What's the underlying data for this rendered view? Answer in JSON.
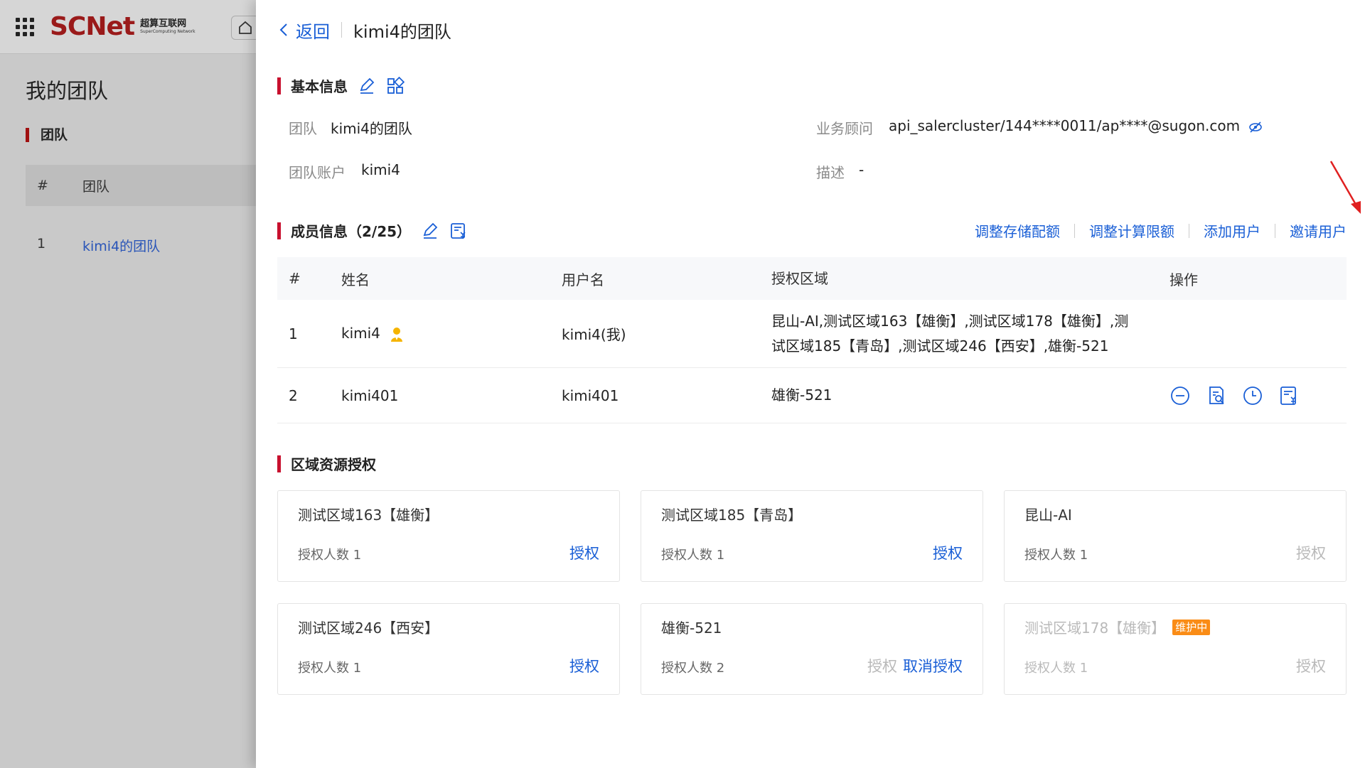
{
  "background_page": {
    "logo_main": "SCNet",
    "logo_cn": "超算互联网",
    "logo_en": "SuperComputing Network",
    "title": "我的团队",
    "section": "团队",
    "table_headers": [
      "#",
      "团队"
    ],
    "rows": [
      {
        "index": "1",
        "name": "kimi4的团队"
      }
    ]
  },
  "header": {
    "back_label": "返回",
    "title": "kimi4的团队"
  },
  "basic_info": {
    "heading": "基本信息",
    "team_label": "团队",
    "team_value": "kimi4的团队",
    "account_label": "团队账户",
    "account_value": "kimi4",
    "advisor_label": "业务顾问",
    "advisor_value": "api_salercluster/144****0011/ap****@sugon.com",
    "desc_label": "描述",
    "desc_value": "-"
  },
  "members": {
    "heading": "成员信息（2/25）",
    "actions": [
      "调整存储配额",
      "调整计算限额",
      "添加用户",
      "邀请用户"
    ],
    "headers": [
      "#",
      "姓名",
      "用户名",
      "授权区域",
      "操作"
    ],
    "rows": [
      {
        "index": "1",
        "name": "kimi4",
        "username": "kimi4(我)",
        "areas_line1": "昆山-AI,测试区域163【雄衡】,测试区域178【雄衡】,测",
        "areas_line2": "试区域185【青岛】,测试区域246【西安】,雄衡-521"
      },
      {
        "index": "2",
        "name": "kimi401",
        "username": "kimi401",
        "areas_line1": "雄衡-521",
        "areas_line2": ""
      }
    ]
  },
  "regions": {
    "heading": "区域资源授权",
    "cards": [
      {
        "title": "测试区域163【雄衡】",
        "count": "授权人数 1",
        "btn1": "授权"
      },
      {
        "title": "测试区域185【青岛】",
        "count": "授权人数 1",
        "btn1": "授权"
      },
      {
        "title": "昆山-AI",
        "count": "授权人数 1",
        "btn1": "授权"
      },
      {
        "title": "测试区域246【西安】",
        "count": "授权人数 1",
        "btn1": "授权"
      },
      {
        "title": "雄衡-521",
        "count": "授权人数 2",
        "btn1": "授权",
        "btn2": "取消授权"
      },
      {
        "title": "测试区域178【雄衡】",
        "count": "授权人数 1",
        "btn1": "授权",
        "badge": "维护中"
      }
    ]
  },
  "colors": {
    "accent": "#1a5fd6",
    "brand_red": "#c8102e",
    "warning": "#fa8c16"
  }
}
